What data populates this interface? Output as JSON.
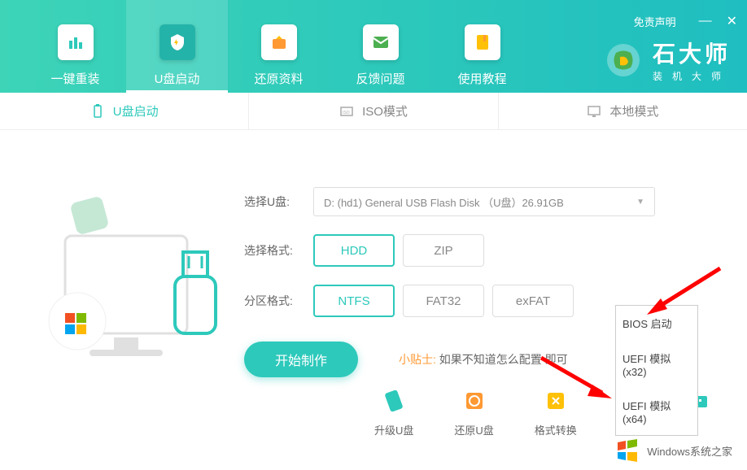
{
  "window": {
    "disclaimer": "免责声明",
    "minimize": "—",
    "close": "✕"
  },
  "logo": {
    "title": "石大师",
    "subtitle": "装机大师"
  },
  "nav": [
    {
      "label": "一键重装",
      "icon": "bars"
    },
    {
      "label": "U盘启动",
      "icon": "usb",
      "active": true
    },
    {
      "label": "还原资料",
      "icon": "restore"
    },
    {
      "label": "反馈问题",
      "icon": "feedback"
    },
    {
      "label": "使用教程",
      "icon": "tutorial"
    }
  ],
  "modes": [
    {
      "label": "U盘启动",
      "active": true
    },
    {
      "label": "ISO模式",
      "active": false
    },
    {
      "label": "本地模式",
      "active": false
    }
  ],
  "form": {
    "disk_label": "选择U盘:",
    "disk_value": "D: (hd1) General USB Flash Disk （U盘）26.91GB",
    "format_label": "选择格式:",
    "format_options": [
      "HDD",
      "ZIP"
    ],
    "format_selected": "HDD",
    "partition_label": "分区格式:",
    "partition_options": [
      "NTFS",
      "FAT32",
      "exFAT"
    ],
    "partition_selected": "NTFS"
  },
  "action": {
    "start": "开始制作",
    "tip_label": "小贴士:",
    "tip_text": "如果不知道怎么配置                即可"
  },
  "boot_menu": [
    "BIOS 启动",
    "UEFI 模拟(x32)",
    "UEFI 模拟(x64)"
  ],
  "tools": [
    {
      "label": "升级U盘"
    },
    {
      "label": "还原U盘"
    },
    {
      "label": "格式转换"
    },
    {
      "label": ""
    },
    {
      "label": ""
    }
  ],
  "watermark": "Windows系统之家"
}
